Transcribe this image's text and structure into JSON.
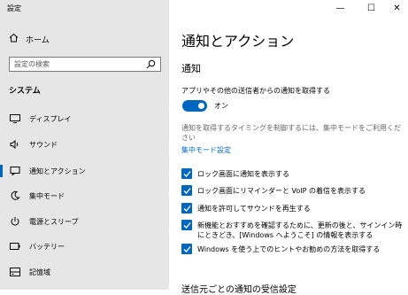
{
  "window": {
    "title": "設定",
    "controls": {
      "minimize": "—",
      "maximize": "☐",
      "close": "✕"
    }
  },
  "sidebar": {
    "home_label": "ホーム",
    "search_placeholder": "設定の検索",
    "section_label": "システム",
    "items": [
      {
        "label": "ディスプレイ",
        "icon": "display-icon"
      },
      {
        "label": "サウンド",
        "icon": "sound-icon"
      },
      {
        "label": "通知とアクション",
        "icon": "notifications-icon",
        "selected": true
      },
      {
        "label": "集中モード",
        "icon": "focus-assist-icon"
      },
      {
        "label": "電源とスリープ",
        "icon": "power-icon"
      },
      {
        "label": "バッテリー",
        "icon": "battery-icon"
      },
      {
        "label": "記憶域",
        "icon": "storage-icon"
      }
    ]
  },
  "main": {
    "page_title": "通知とアクション",
    "section_title": "通知",
    "toggle_label": "アプリやその他の送信者からの通知を取得する",
    "toggle_state": "オン",
    "description": "通知を取得するタイミングを制御するには、集中モードをご利用ください",
    "link_text": "集中モード設定",
    "checkboxes": [
      {
        "label": "ロック画面に通知を表示する",
        "checked": true
      },
      {
        "label": "ロック画面にリマインダーと VoIP の着信を表示する",
        "checked": true
      },
      {
        "label": "通知を許可してサウンドを再生する",
        "checked": true
      },
      {
        "label": "新機能とおすすめを確認するために、更新の後と、サインイン時にときどき、[Windows へようこそ] の情報を表示する",
        "checked": true
      },
      {
        "label": "Windows を使う上でのヒントやお勧めの方法を取得する",
        "checked": true
      }
    ],
    "next_section": "送信元ごとの通知の受信設定"
  },
  "colors": {
    "accent": "#0067c0",
    "sidebar_bg": "#e6e6e6"
  }
}
